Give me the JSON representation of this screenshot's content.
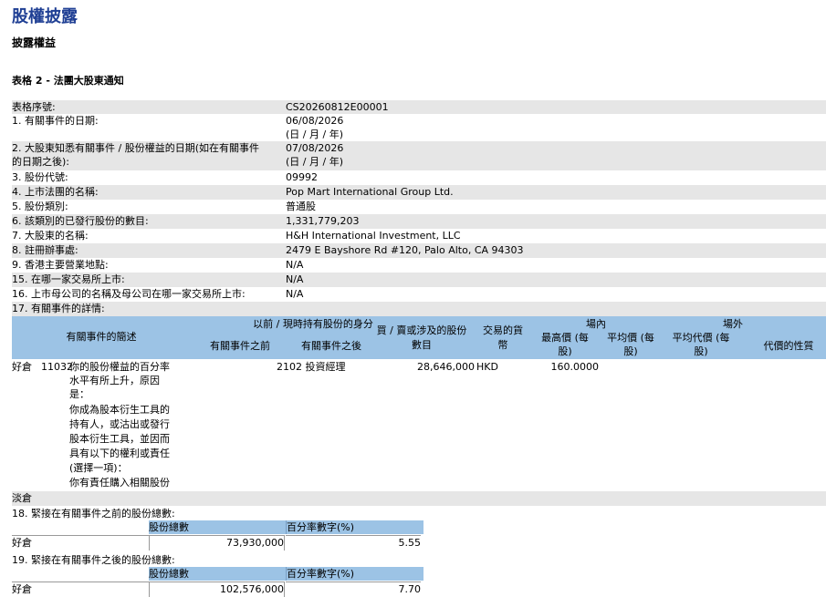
{
  "page": {
    "title": "股權披露",
    "subtitle": "披露權益",
    "form_title": "表格 2 - 法團大股東通知"
  },
  "fields": [
    {
      "label": "表格序號:",
      "value": "CS20260812E00001"
    },
    {
      "label": "1. 有關事件的日期:",
      "value": "06/08/2026",
      "note": "(日 / 月 / 年)"
    },
    {
      "label": "2. 大股東知悉有關事件 / 股份權益的日期(如在有關事件",
      "label2": "的日期之後):",
      "value": "07/08/2026",
      "note": "(日 / 月 / 年)"
    },
    {
      "label": "3. 股份代號:",
      "value": "09992"
    },
    {
      "label": "4. 上市法團的名稱:",
      "value": "Pop Mart International Group Ltd."
    },
    {
      "label": "5. 股份類別:",
      "value": "普通股"
    },
    {
      "label": "6. 該類別的已發行股份的數目:",
      "value": "1,331,779,203"
    },
    {
      "label": "7. 大股東的名稱:",
      "value": "H&H International Investment, LLC"
    },
    {
      "label": "8. 註冊辦事處:",
      "value": "2479 E Bayshore Rd #120, Palo Alto, CA 94303"
    },
    {
      "label": "9. 香港主要營業地點:",
      "value": "N/A"
    },
    {
      "label": "15. 在哪一家交易所上市:",
      "value": "N/A"
    },
    {
      "label": "16. 上市母公司的名稱及母公司在哪一家交易所上市:",
      "value": "N/A"
    },
    {
      "label": "17. 有關事件的詳情:",
      "value": ""
    }
  ],
  "event_table": {
    "headers": {
      "event_code": "有關事件的簡述",
      "capacity_group": "以前 / 現時持有股份的身分",
      "before": "有關事件之前",
      "after": "有關事件之後",
      "shares_line1": "買 / 賣或涉及的股份",
      "shares_line2": "數目",
      "currency_line1": "交易的貨",
      "currency_line2": "幣",
      "onex": "場內",
      "high_line1": "最高價 (每",
      "high_line2": "股)",
      "avg_line1": "平均價 (每",
      "avg_line2": "股)",
      "offex": "場外",
      "consid_line1": "平均代價 (每",
      "consid_line2": "股)",
      "nature": "代價的性質"
    },
    "row": {
      "position": "好倉",
      "code": "11032",
      "desc": [
        "你的股份權益的百分率",
        "水平有所上升，原因",
        "是：",
        "你成為股本衍生工具的",
        "持有人，或沽出或發行",
        "股本衍生工具，並因而",
        "具有以下的權利或責任",
        "(選擇一項)：",
        "你有責任購入相關股份"
      ],
      "capacity": "2102 投資經理",
      "shares": "28,646,000",
      "currency": "HKD",
      "high": "160.0000"
    },
    "short_label": "淡倉"
  },
  "section18": {
    "label": "18. 緊接在有關事件之前的股份總數:",
    "col1": "股份總數",
    "col2": "百分率數字(%)",
    "row_label": "好倉",
    "shares": "73,930,000",
    "percent": "5.55"
  },
  "section19": {
    "label": "19. 緊接在有關事件之後的股份總數:",
    "col1": "股份總數",
    "col2": "百分率數字(%)",
    "row_label": "好倉",
    "shares": "102,576,000",
    "percent": "7.70"
  },
  "colors": {
    "title": "#1f3f94",
    "header": "#9cc3e5",
    "shade": "#e6e6e6"
  }
}
